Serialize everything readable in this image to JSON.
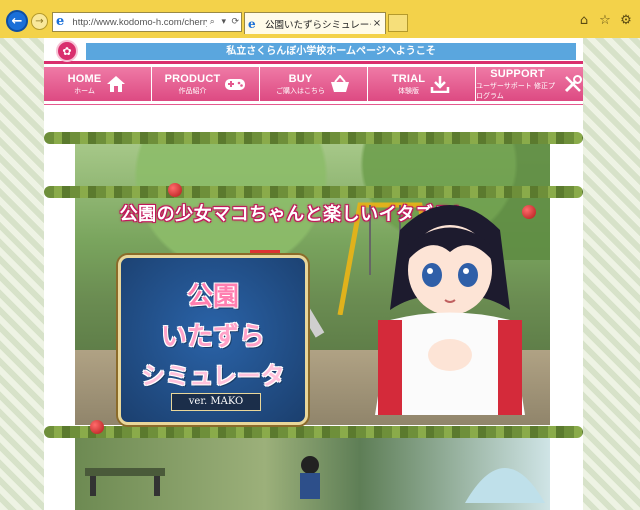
{
  "browser": {
    "address_url": "http://www.kodomo-h.com/cherry/p",
    "tab_title": "公園いたずらシミュレータ_紹..."
  },
  "site": {
    "welcome": "私立さくらんぼ小学校ホームページへようこそ",
    "nav": [
      {
        "en": "HOME",
        "ja": "ホーム",
        "icon": "home-icon"
      },
      {
        "en": "PRODUCT",
        "ja": "作品紹介",
        "icon": "gamepad-icon"
      },
      {
        "en": "BUY",
        "ja": "ご購入はこちら",
        "icon": "basket-icon"
      },
      {
        "en": "TRIAL",
        "ja": "体験版",
        "icon": "download-icon"
      },
      {
        "en": "SUPPORT",
        "ja": "ユーザーサポート 修正プログラム",
        "icon": "tools-icon"
      }
    ]
  },
  "banner": {
    "tagline": "公園の少女マコちゃんと楽しいイタズラ！",
    "title_line1": "公園",
    "title_line2": "いたずら",
    "title_line3": "シミュレータ",
    "version": "ver. MAKO"
  },
  "colors": {
    "chrome": "#f3d24a",
    "nav_pink": "#e4598e",
    "welcome_blue": "#5aa6de"
  }
}
